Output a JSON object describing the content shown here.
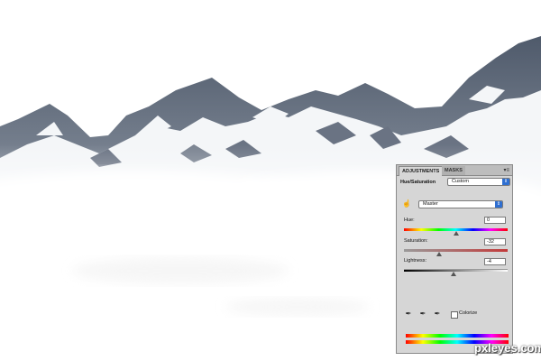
{
  "panel": {
    "tabs": [
      "ADJUSTMENTS",
      "MASKS"
    ],
    "menu_icon": "panel-menu-icon",
    "adjustment_name": "Hue/Saturation",
    "preset_value": "Custom",
    "channel_value": "Master",
    "hue": {
      "label": "Hue:",
      "value": "0",
      "level": 0.5
    },
    "saturation": {
      "label": "Saturation:",
      "value": "-32",
      "level": 0.34
    },
    "lightness": {
      "label": "Lightness:",
      "value": "-4",
      "level": 0.48
    },
    "colorize_label": "Colorize",
    "colorize_checked": false,
    "icons": [
      "hand-icon",
      "eyedropper-icon",
      "eyedropper-plus-icon",
      "eyedropper-minus-icon"
    ]
  },
  "watermark": "pxleyes.com",
  "colors": {
    "panel_bg": "#d6d6d6",
    "select_arrow": "#2f6fd1",
    "rock": "#5d6878",
    "snow": "#f4f6f8"
  }
}
